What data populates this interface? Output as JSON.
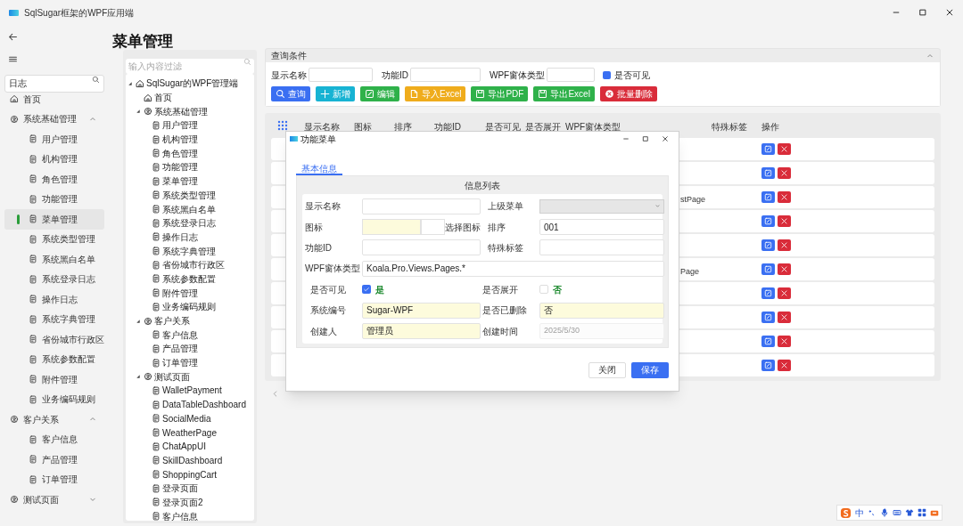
{
  "window": {
    "title": "SqlSugar框架的WPF应用端"
  },
  "nav": {
    "search": {
      "value": "日志"
    },
    "items": [
      {
        "label": "首页",
        "kind": "home",
        "selected": false
      },
      {
        "label": "系统基础管理",
        "kind": "group",
        "expanded": true,
        "selected": false,
        "children": [
          {
            "label": "用户管理",
            "kind": "page",
            "selected": false
          },
          {
            "label": "机构管理",
            "kind": "page",
            "selected": false
          },
          {
            "label": "角色管理",
            "kind": "page",
            "selected": false
          },
          {
            "label": "功能管理",
            "kind": "page",
            "selected": false
          },
          {
            "label": "菜单管理",
            "kind": "page",
            "selected": true
          },
          {
            "label": "系统类型管理",
            "kind": "page",
            "selected": false
          },
          {
            "label": "系统黑白名单",
            "kind": "page",
            "selected": false
          },
          {
            "label": "系统登录日志",
            "kind": "page",
            "selected": false
          },
          {
            "label": "操作日志",
            "kind": "page",
            "selected": false
          },
          {
            "label": "系统字典管理",
            "kind": "page",
            "selected": false
          },
          {
            "label": "省份城市行政区",
            "kind": "page",
            "selected": false
          },
          {
            "label": "系统参数配置",
            "kind": "page",
            "selected": false
          },
          {
            "label": "附件管理",
            "kind": "page",
            "selected": false
          },
          {
            "label": "业务编码规则",
            "kind": "page",
            "selected": false
          }
        ]
      },
      {
        "label": "客户关系",
        "kind": "group",
        "expanded": true,
        "selected": false,
        "children": [
          {
            "label": "客户信息",
            "kind": "page",
            "selected": false
          },
          {
            "label": "产品管理",
            "kind": "page",
            "selected": false
          },
          {
            "label": "订单管理",
            "kind": "page",
            "selected": false
          }
        ]
      },
      {
        "label": "测试页面",
        "kind": "group",
        "expanded": false,
        "selected": false
      }
    ]
  },
  "page_title": "菜单管理",
  "tree": {
    "filter": {
      "placeholder": "输入内容过滤"
    },
    "nodes": [
      {
        "label": "SqlSugar的WPF管理端",
        "kind": "home",
        "expanded": true,
        "children": [
          {
            "label": "首页",
            "kind": "home"
          },
          {
            "label": "系统基础管理",
            "kind": "group",
            "expanded": true,
            "children": [
              {
                "label": "用户管理",
                "kind": "page"
              },
              {
                "label": "机构管理",
                "kind": "page"
              },
              {
                "label": "角色管理",
                "kind": "page"
              },
              {
                "label": "功能管理",
                "kind": "page"
              },
              {
                "label": "菜单管理",
                "kind": "page"
              },
              {
                "label": "系统类型管理",
                "kind": "page"
              },
              {
                "label": "系统黑白名单",
                "kind": "page"
              },
              {
                "label": "系统登录日志",
                "kind": "page"
              },
              {
                "label": "操作日志",
                "kind": "page"
              },
              {
                "label": "系统字典管理",
                "kind": "page"
              },
              {
                "label": "省份城市行政区",
                "kind": "page"
              },
              {
                "label": "系统参数配置",
                "kind": "page"
              },
              {
                "label": "附件管理",
                "kind": "page"
              },
              {
                "label": "业务编码规则",
                "kind": "page"
              }
            ]
          },
          {
            "label": "客户关系",
            "kind": "group",
            "expanded": true,
            "children": [
              {
                "label": "客户信息",
                "kind": "page"
              },
              {
                "label": "产品管理",
                "kind": "page"
              },
              {
                "label": "订单管理",
                "kind": "page"
              }
            ]
          },
          {
            "label": "测试页面",
            "kind": "group",
            "expanded": true,
            "children": [
              {
                "label": "WalletPayment",
                "kind": "page"
              },
              {
                "label": "DataTableDashboard",
                "kind": "page"
              },
              {
                "label": "SocialMedia",
                "kind": "page"
              },
              {
                "label": "WeatherPage",
                "kind": "page"
              },
              {
                "label": "ChatAppUI",
                "kind": "page"
              },
              {
                "label": "SkillDashboard",
                "kind": "page"
              },
              {
                "label": "ShoppingCart",
                "kind": "page"
              },
              {
                "label": "登录页面",
                "kind": "page"
              },
              {
                "label": "登录页面2",
                "kind": "page"
              },
              {
                "label": "客户信息",
                "kind": "page"
              }
            ]
          }
        ]
      }
    ]
  },
  "query": {
    "title": "查询条件",
    "expanded": true,
    "fields": [
      {
        "label": "显示名称"
      },
      {
        "label": "功能ID"
      },
      {
        "label": "WPF窗体类型"
      }
    ],
    "visible_filter": {
      "label": "是否可见",
      "checked": true
    },
    "buttons": [
      {
        "label": "查询",
        "kind": "search",
        "color": "#3a6ff2"
      },
      {
        "label": "新增",
        "kind": "add",
        "color": "#17b3d3"
      },
      {
        "label": "编辑",
        "kind": "edit",
        "color": "#2fb14a"
      },
      {
        "label": "导入Excel",
        "kind": "import",
        "color": "#efac1c"
      },
      {
        "label": "导出PDF",
        "kind": "export",
        "color": "#2fb14a"
      },
      {
        "label": "导出Excel",
        "kind": "export",
        "color": "#2fb14a"
      },
      {
        "label": "批量删除",
        "kind": "delete",
        "color": "#d92c3a"
      }
    ]
  },
  "table": {
    "columns": [
      "显示名称",
      "图标",
      "排序",
      "功能ID",
      "是否可见",
      "是否展开",
      "WPF窗体类型",
      "特殊标签",
      "操作"
    ],
    "rows": [
      {},
      {},
      {
        "wpf_window_type": "stPage"
      },
      {},
      {},
      {
        "wpf_window_type": "Page"
      },
      {},
      {},
      {},
      {}
    ]
  },
  "dialog": {
    "title": "功能菜单",
    "tabs": [
      {
        "label": "基本信息",
        "selected": true
      }
    ],
    "section_title": "信息列表",
    "fields": [
      {
        "label": "显示名称",
        "kind": "text",
        "readonly": false
      },
      {
        "label": "上级菜单",
        "kind": "dropdown"
      },
      {
        "label": "图标",
        "kind": "icon_picker",
        "button": "选择图标"
      },
      {
        "label": "排序",
        "kind": "text",
        "value": "001",
        "readonly": false
      },
      {
        "label": "功能ID",
        "kind": "text",
        "readonly": false
      },
      {
        "label": "特殊标签",
        "kind": "text",
        "readonly": false
      },
      {
        "label": "WPF窗体类型",
        "kind": "text",
        "value": "Koala.Pro.Views.Pages.*",
        "readonly": false,
        "wide": true
      },
      {
        "label": "是否可见",
        "kind": "checkbox",
        "checked": true,
        "text": "是"
      },
      {
        "label": "是否展开",
        "kind": "checkbox",
        "checked": false,
        "text": "否"
      },
      {
        "label": "系统编号",
        "kind": "text",
        "value": "Sugar-WPF",
        "readonly": true
      },
      {
        "label": "是否已删除",
        "kind": "text",
        "value": "否",
        "readonly": true
      },
      {
        "label": "创建人",
        "kind": "text",
        "value": "管理员",
        "readonly": true
      },
      {
        "label": "创建时间",
        "kind": "date",
        "value": "2025/5/30",
        "disabled": true
      }
    ],
    "buttons": [
      {
        "label": "关闭",
        "kind": "secondary"
      },
      {
        "label": "保存",
        "kind": "primary"
      }
    ]
  },
  "ime": {
    "mode": "中"
  }
}
